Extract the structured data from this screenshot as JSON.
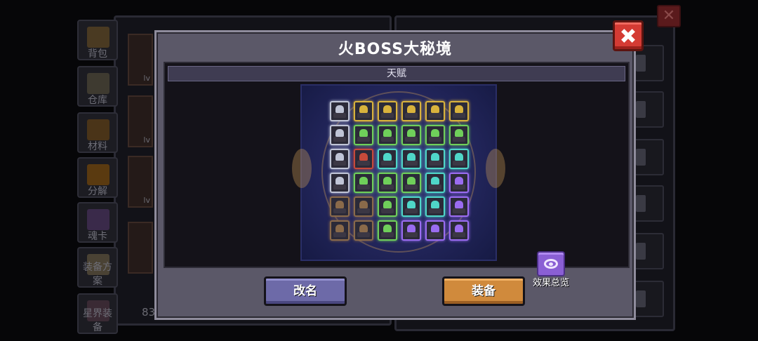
{
  "modal": {
    "title": "火BOSS大秘境",
    "section_header": "天赋",
    "effect_overview_label": "效果总览",
    "rename_label": "改名",
    "equip_label": "装备",
    "close_icon": "close-icon"
  },
  "background": {
    "sidebar_items": [
      {
        "label": "背包",
        "icon": "backpack-icon"
      },
      {
        "label": "仓库",
        "icon": "warehouse-icon"
      },
      {
        "label": "材料",
        "icon": "materials-icon"
      },
      {
        "label": "分解",
        "icon": "decompose-icon"
      },
      {
        "label": "魂卡",
        "icon": "soul-card-icon"
      },
      {
        "label": "装备方案",
        "icon": "equipment-plan-icon"
      },
      {
        "label": "星界装备",
        "icon": "astral-equipment-icon"
      }
    ],
    "card_labels": [
      "lv",
      "lv",
      "lv"
    ],
    "partial_stat": "83"
  },
  "talent_board": {
    "columns": 6,
    "rows": 6,
    "colors": {
      "silver": "#bfc4d6",
      "gold": "#d8b23c",
      "green": "#6fcf5a",
      "cyan": "#4fd6c8",
      "purple": "#9a6cf0",
      "red": "#c64a3a",
      "brown": "#8a6a4a"
    },
    "nodes": [
      [
        "silver",
        "gold",
        "gold",
        "gold",
        "gold",
        "gold"
      ],
      [
        "silver",
        "green",
        "green",
        "green",
        "green",
        "green"
      ],
      [
        "silver",
        "red",
        "cyan",
        "cyan",
        "cyan",
        "cyan"
      ],
      [
        "silver",
        "green",
        "green",
        "green",
        "cyan",
        "purple"
      ],
      [
        "brown",
        "brown",
        "green",
        "cyan",
        "cyan",
        "purple"
      ],
      [
        "brown",
        "brown",
        "green",
        "purple",
        "purple",
        "purple"
      ]
    ]
  }
}
